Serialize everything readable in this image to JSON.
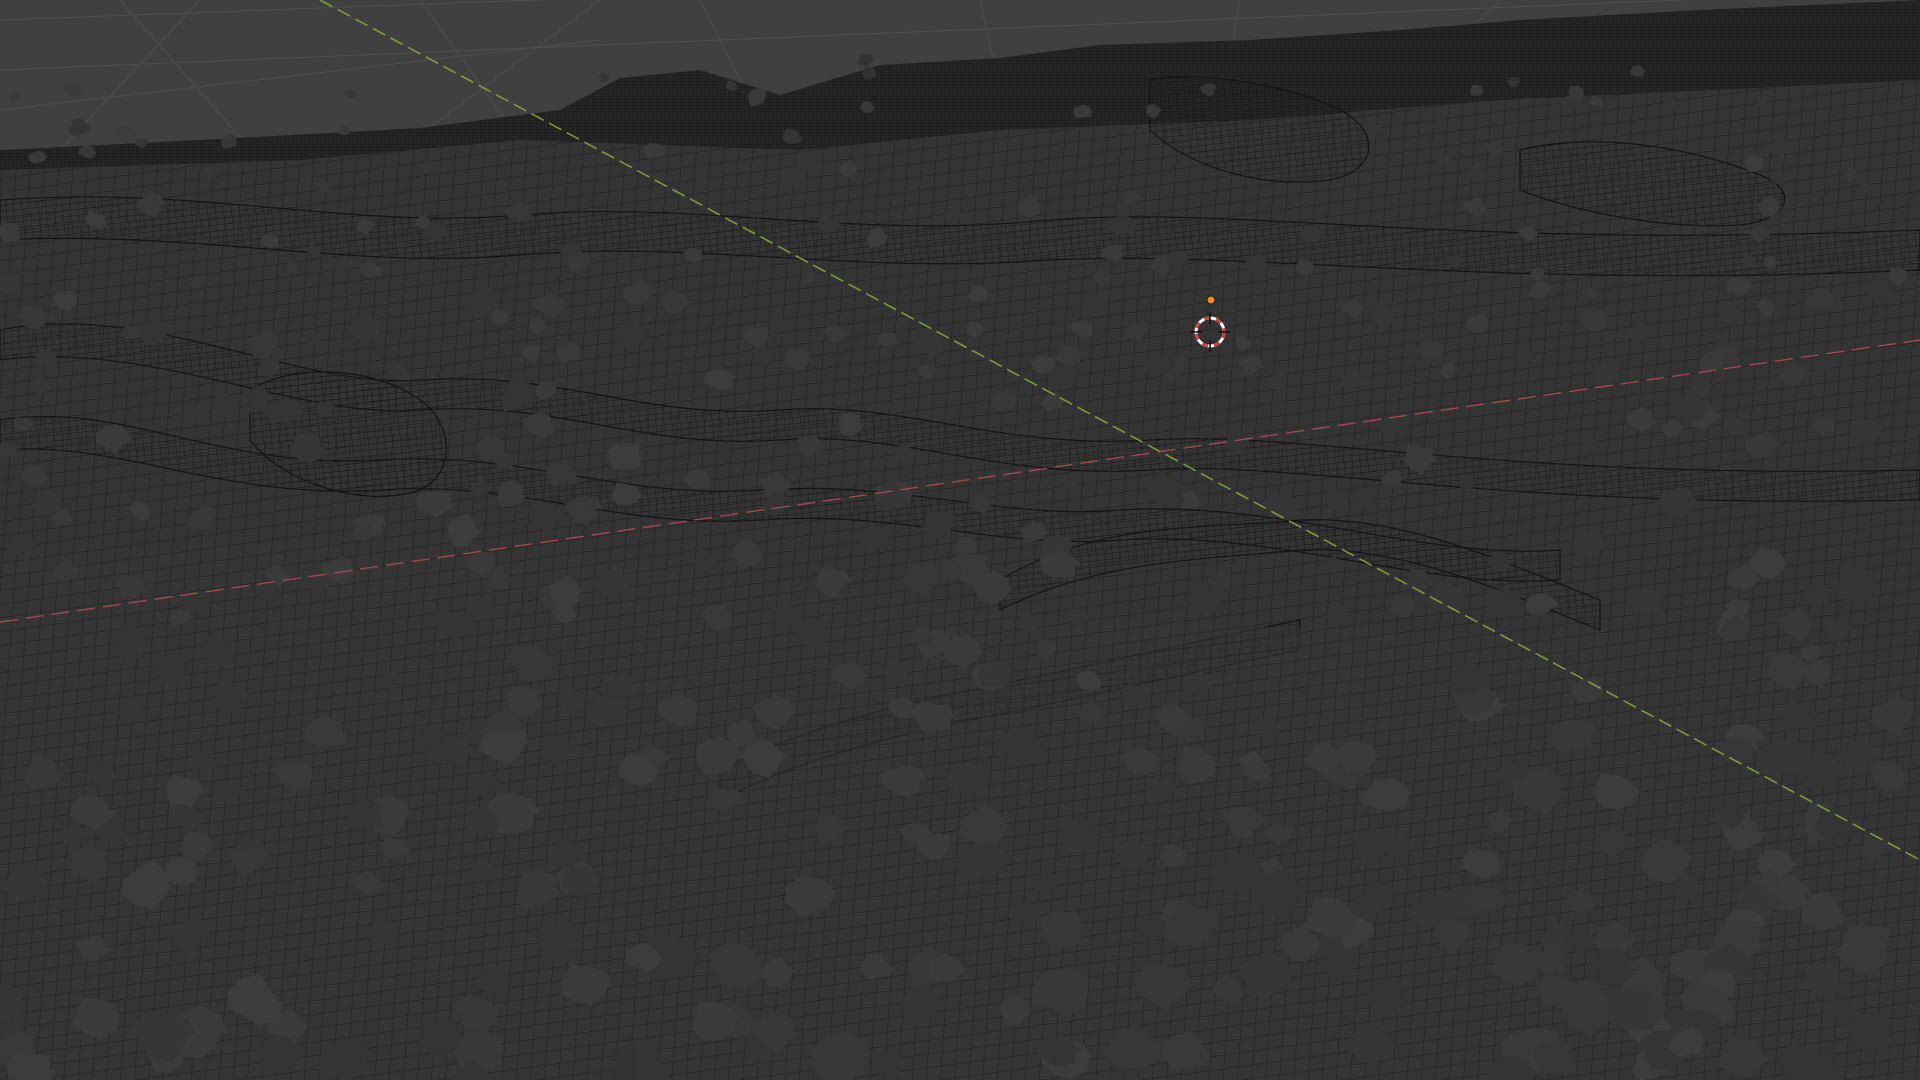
{
  "viewport": {
    "background_color": "#3a3a3a",
    "sky_color": "#404040",
    "terrain_color": "#333333",
    "wire_color": "#1c1c1c",
    "blob_color": "#383838",
    "axis_x_color": "#c8505a",
    "axis_y_color": "#8aad3c",
    "cursor_icon": "3d-cursor-icon",
    "origin_icon": "object-origin-icon",
    "origin_color": "#f08c1e"
  }
}
